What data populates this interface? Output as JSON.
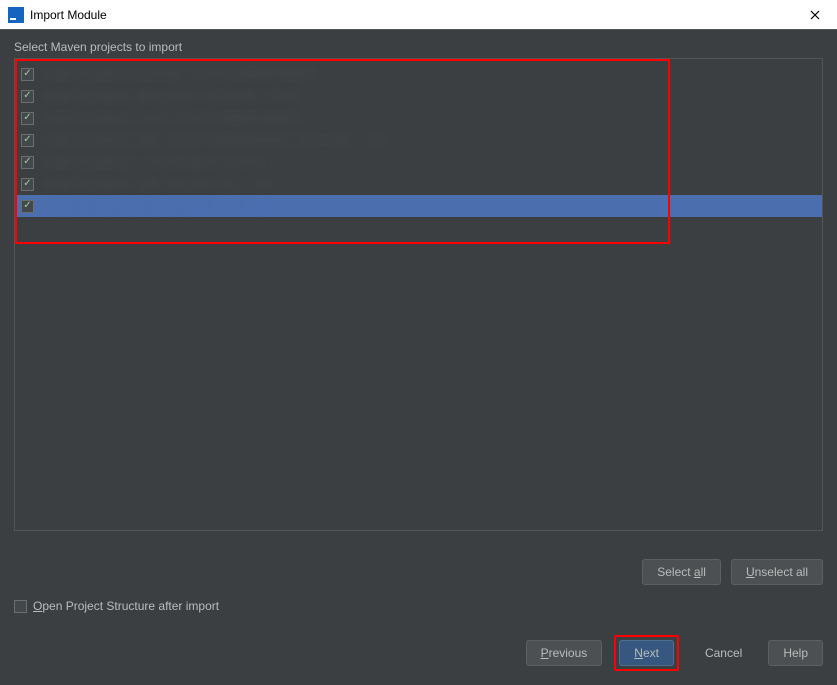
{
  "window": {
    "title": "Import Module"
  },
  "instruction": "Select Maven projects to import",
  "projects": [
    {
      "checked": true,
      "selected": false,
      "text": "com.example:parent:1.0.0-SNAPSHOT"
    },
    {
      "checked": true,
      "selected": false,
      "text": "com.example:mavente-module:1.0.0"
    },
    {
      "checked": true,
      "selected": false,
      "text": "com.example:core:1.0.0-SNAPSHOT"
    },
    {
      "checked": true,
      "selected": false,
      "text": "com.example:api:1.0.0-SNAPSHOT [active] ::pic"
    },
    {
      "checked": true,
      "selected": false,
      "text": "com.example:t-fk-module:1.0.0"
    },
    {
      "checked": true,
      "selected": false,
      "text": "com.example:api-server \\d  s-ser"
    },
    {
      "checked": true,
      "selected": true,
      "text": "c   op,         s-se               -wrs-api-se . . . .    .e]"
    }
  ],
  "buttons": {
    "select_all_pre": "Select ",
    "select_all_mn": "a",
    "select_all_post": "ll",
    "unselect_all_mn": "U",
    "unselect_all_post": "nselect all",
    "previous_mn": "P",
    "previous_post": "revious",
    "next_mn": "N",
    "next_post": "ext",
    "cancel": "Cancel",
    "help": "Help"
  },
  "options": {
    "open_project_structure_mn": "O",
    "open_project_structure_post": "pen Project Structure after import",
    "open_project_structure_checked": false
  }
}
